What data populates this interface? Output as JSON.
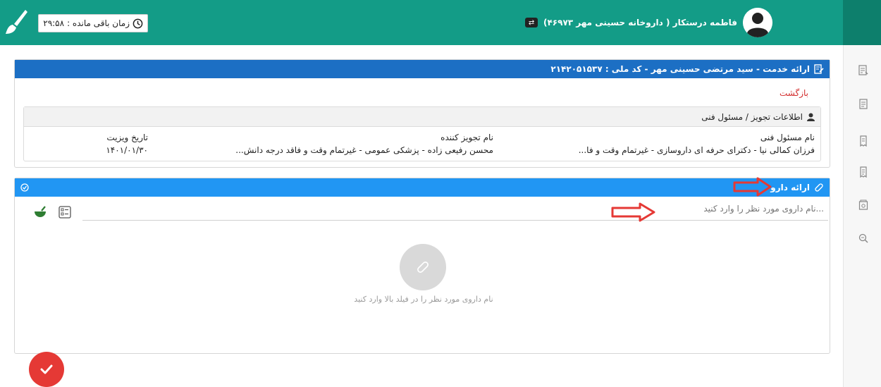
{
  "header": {
    "timer_label": "زمان باقی مانده :",
    "timer_value": "۲۹:۵۸",
    "user_name": "فاطمه درستکار ( داروخانه حسینی مهر ۴۶۹۷۳)",
    "brand_color": "#139c87"
  },
  "service_panel": {
    "title": "ارائه خدمت - سید مرتضی حسینی مهر - کد ملی : ۲۱۴۲۰۵۱۵۳۷",
    "back_label": "بازگشت",
    "info_box": {
      "title": "اطلاعات تجویز / مسئول فنی",
      "technical_label": "نام مسئول فنی",
      "technical_value": "فرزان کمالی نیا - دکترای حرفه ای داروسازی - غیرتمام وقت و فا...",
      "prescriber_label": "نام تجویز کننده",
      "prescriber_value": "محسن رفیعی زاده - پزشکی عمومی - غیرتمام وقت و فاقد درجه دانش...",
      "visit_label": "تاریخ ویزیت",
      "visit_value": "۱۴۰۱/۰۱/۳۰"
    }
  },
  "drug_panel": {
    "title": "ارائه دارو",
    "search_placeholder": "...نام داروی مورد نظر را وارد کنید",
    "empty_message": "نام داروی مورد نظر را در فیلد بالا وارد کنید"
  },
  "icons": {
    "brush": "brush-icon",
    "clock": "clock-icon",
    "swap": "swap-icon",
    "edit": "edit-document-icon",
    "user": "user-icon",
    "pill": "pill-icon",
    "list": "list-icon",
    "mortar": "mortar-icon",
    "check": "check-icon"
  }
}
